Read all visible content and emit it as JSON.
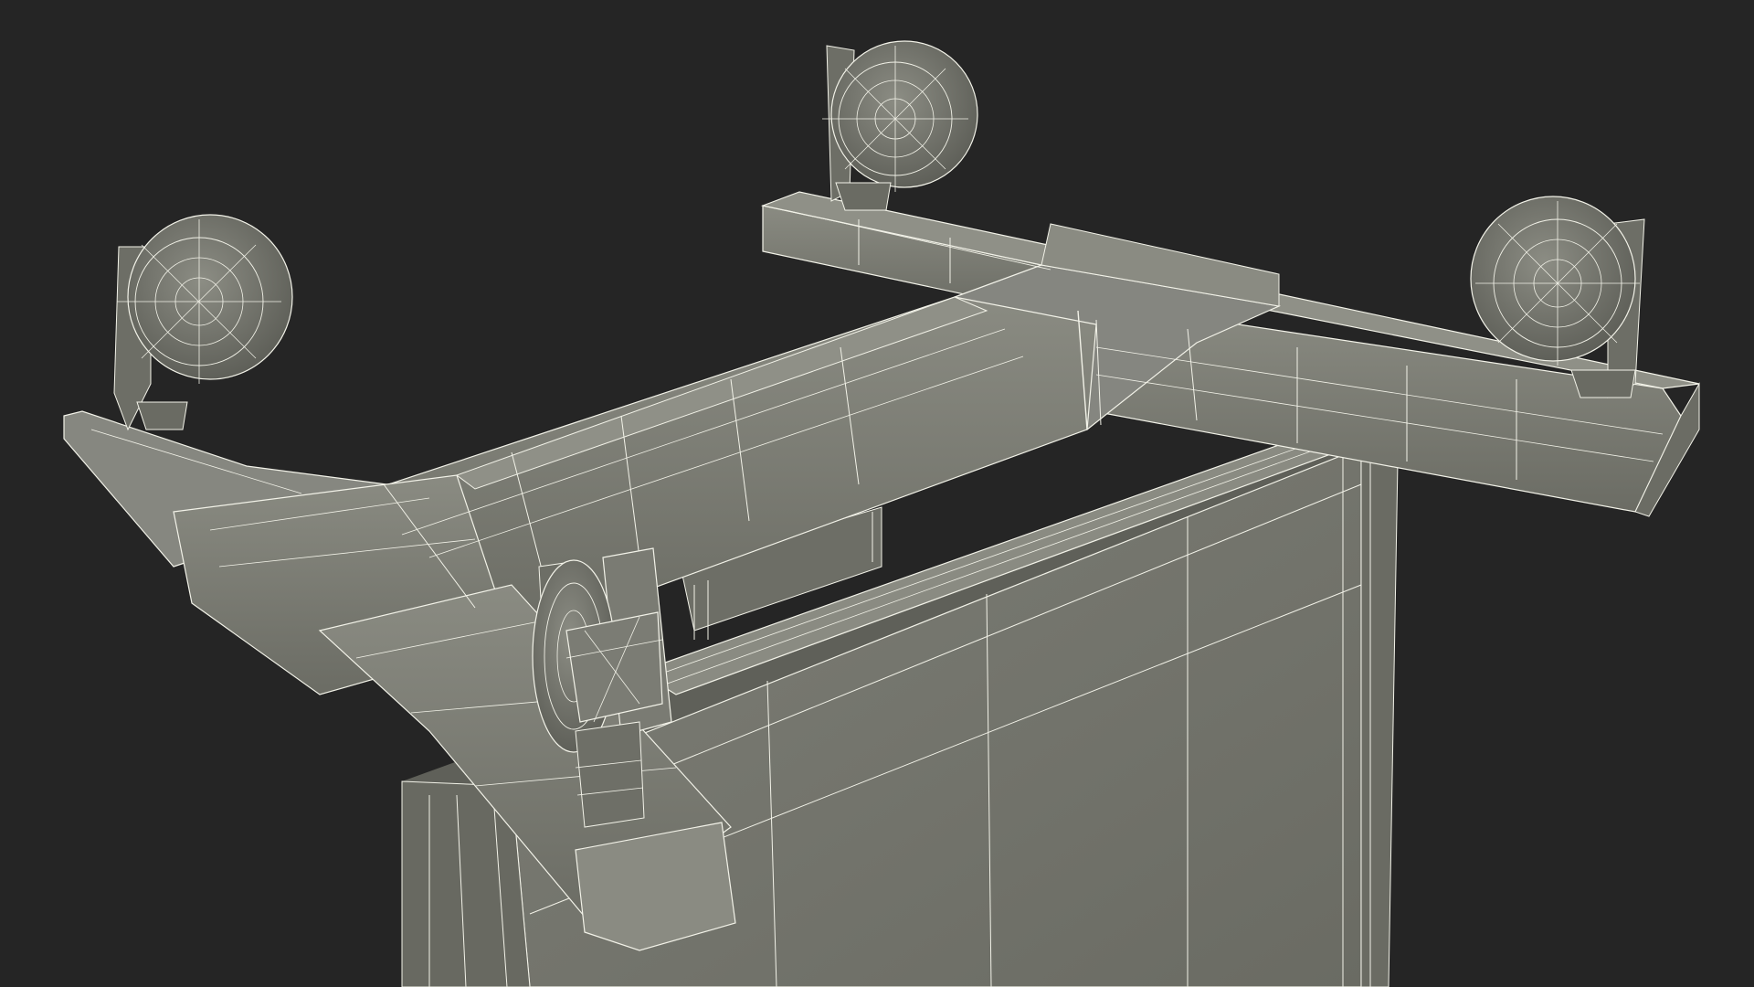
{
  "scene": {
    "subject": "3d-wireframe-model",
    "background_color": "#252525",
    "surface_color": "#777870",
    "surface_shadow_color": "#5e5f58",
    "surface_light_color": "#8a8b82",
    "wire_color": "#f2f2e8",
    "components": [
      {
        "name": "wheel-back-left",
        "icon": "caster-wheel-icon"
      },
      {
        "name": "wheel-back-center",
        "icon": "caster-wheel-icon"
      },
      {
        "name": "wheel-back-right",
        "icon": "caster-wheel-icon"
      },
      {
        "name": "wheel-front",
        "icon": "caster-wheel-icon"
      },
      {
        "name": "cross-base-frame",
        "icon": "frame-icon"
      },
      {
        "name": "panel-body",
        "icon": "panel-icon"
      }
    ]
  }
}
